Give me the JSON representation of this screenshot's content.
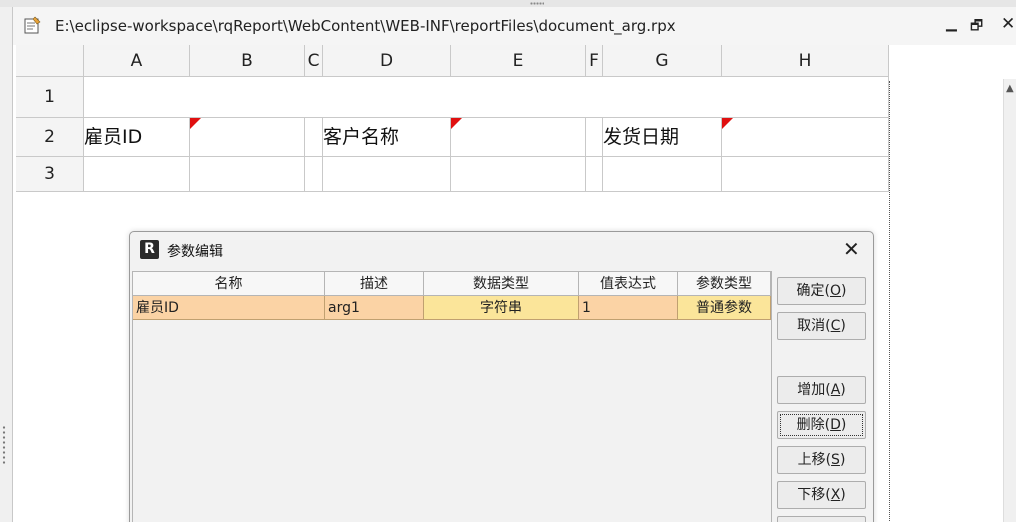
{
  "window": {
    "path": "E:\\eclipse-workspace\\rqReport\\WebContent\\WEB-INF\\reportFiles\\document_arg.rpx",
    "min_icon": "minimize-icon",
    "restore_icon": "restore-icon",
    "close_icon": "close-icon"
  },
  "sheet": {
    "columns": [
      "A",
      "B",
      "C",
      "D",
      "E",
      "F",
      "G",
      "H"
    ],
    "rows": [
      "1",
      "2",
      "3"
    ],
    "cells": {
      "A2": "雇员ID",
      "D2": "客户名称",
      "G2": "发货日期"
    },
    "flag_color": "#e01010"
  },
  "dialog": {
    "title": "参数编辑",
    "icon": "R",
    "columns": [
      "名称",
      "描述",
      "数据类型",
      "值表达式",
      "参数类型"
    ],
    "rows": [
      [
        "雇员ID",
        "arg1",
        "字符串",
        "1",
        "普通参数"
      ]
    ],
    "buttons": {
      "ok": {
        "text": "确定(",
        "key": "O",
        "end": ")"
      },
      "cancel": {
        "text": "取消(",
        "key": "C",
        "end": ")"
      },
      "add": {
        "text": "增加(",
        "key": "A",
        "end": ")"
      },
      "delete": {
        "text": "删除(",
        "key": "D",
        "end": ")"
      },
      "up": {
        "text": "上移(",
        "key": "S",
        "end": ")"
      },
      "down": {
        "text": "下移(",
        "key": "X",
        "end": ")"
      }
    },
    "row_colors": {
      "selected": "#fbd3a5",
      "type_cell": "#fbe59a"
    }
  }
}
